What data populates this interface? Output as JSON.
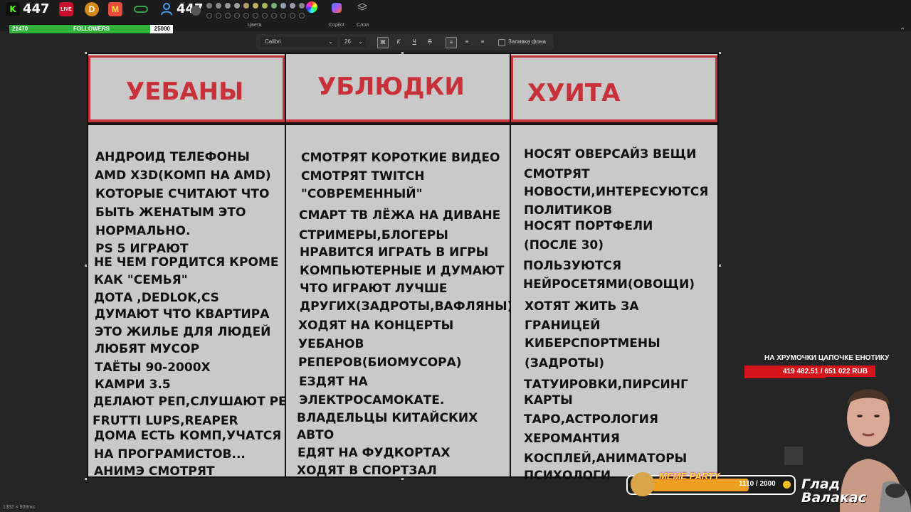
{
  "overlay": {
    "kick_count": "447",
    "live_badge": "LIVE",
    "viewers_count": "447",
    "followers": {
      "current": "21470",
      "label": "FOLLOWERS",
      "goal": "25000",
      "progress": 0.859
    }
  },
  "toolbar": {
    "colors_label": "Цвета",
    "copilot_label": "Copilot",
    "layers_label": "Слои"
  },
  "format": {
    "font": "Calibri",
    "size": "26",
    "bold": "Ж",
    "italic": "К",
    "underline": "Ч",
    "strike": "S",
    "fill_label": "Заливка фона"
  },
  "table": {
    "columns": [
      {
        "header": "УЕБАНЫ",
        "items": [
          "АНДРОИД ТЕЛЕФОНЫ",
          "AMD X3D(КОМП НА AMD)",
          "КОТОРЫЕ СЧИТАЮТ ЧТО",
          "БЫТЬ ЖЕНАТЫМ ЭТО",
          "НОРМАЛЬНО.",
          "PS 5 ИГРАЮТ",
          "НЕ ЧЕМ ГОРДИТСЯ КРОМЕ",
          "КАК \"СЕМЬЯ\"",
          "ДОТА ,DEDLOK,CS",
          "ДУМАЮТ ЧТО КВАРТИРА",
          "ЭТО ЖИЛЬЕ ДЛЯ ЛЮДЕЙ",
          "ЛЮБЯТ МУСОР",
          "ТАЁТЫ 90-2000Х",
          "КАМРИ 3.5",
          "ДЕЛАЮТ РЕП,СЛУШАЮТ РЕП",
          "FRUTTI LUPS,REAPER",
          "ДОМА ЕСТЬ КОМП,УЧАТСЯ",
          "НА ПРОГРАМИСТОВ...",
          "АНИМЭ СМОТРЯТ"
        ]
      },
      {
        "header": "УБЛЮДКИ",
        "items": [
          "СМОТРЯТ КОРОТКИЕ ВИДЕО",
          "СМОТРЯТ TWITCH",
          "\"СОВРЕМЕННЫЙ\"",
          "СМАРТ ТВ ЛЁЖА НА ДИВАНЕ",
          "СТРИМЕРЫ,БЛОГЕРЫ",
          "НРАВИТСЯ ИГРАТЬ В ИГРЫ",
          "КОМПЬЮТЕРНЫЕ И ДУМАЮТ",
          "ЧТО ИГРАЮТ ЛУЧШЕ",
          "ДРУГИХ(ЗАДРОТЫ,ВАФЛЯНЫ)",
          "ХОДЯТ НА КОНЦЕРТЫ",
          "УЕБАНОВ",
          "РЕПЕРОВ(БИОМУСОРА)",
          "ЕЗДЯТ НА",
          "ЭЛЕКТРОСАМОКАТЕ.",
          "ВЛАДЕЛЬЦЫ КИТАЙСКИХ",
          "АВТО",
          "ЕДЯТ НА ФУДКОРТАХ",
          "ХОДЯТ В СПОРТЗАЛ"
        ]
      },
      {
        "header": "ХУИТА",
        "items": [
          "НОСЯТ ОВЕРСАЙЗ ВЕЩИ",
          "СМОТРЯТ",
          "НОВОСТИ,ИНТЕРЕСУЮТСЯ",
          "ПОЛИТИКОВ",
          "НОСЯТ ПОРТФЕЛИ",
          "(ПОСЛЕ 30)",
          "ПОЛЬЗУЮТСЯ",
          "НЕЙРОСЕТЯМИ(ОВОЩИ)",
          "ХОТЯТ ЖИТЬ ЗА",
          "ГРАНИЦЕЙ",
          "КИБЕРСПОРТМЕНЫ",
          "(ЗАДРОТЫ)",
          "ТАТУИРОВКИ,ПИРСИНГ",
          "КАРТЫ",
          "ТАРО,АСТРОЛОГИЯ",
          "ХЕРОМАНТИЯ",
          "КОСПЛЕЙ,АНИМАТОРЫ",
          "ПСИХОЛОГИ"
        ]
      }
    ]
  },
  "donation": {
    "title": "НА ХРУМОЧКИ ЦАПОЧКЕ ЕНОТИКУ",
    "amount": "419 482.51 / 651 022 RUB",
    "progress": 0.644
  },
  "meme_party": {
    "label": "MEME PARTY",
    "count": "1110 / 2000",
    "progress": 0.555
  },
  "streamer": {
    "line1": "Глад",
    "line2": "Валакас"
  },
  "status": {
    "dimensions": "1352 × 908пкс"
  },
  "colors": {
    "accent_red": "#c8303a",
    "kick_green": "#53fc18",
    "followers_green": "#2fb43a",
    "donate_red": "#d5141b"
  }
}
